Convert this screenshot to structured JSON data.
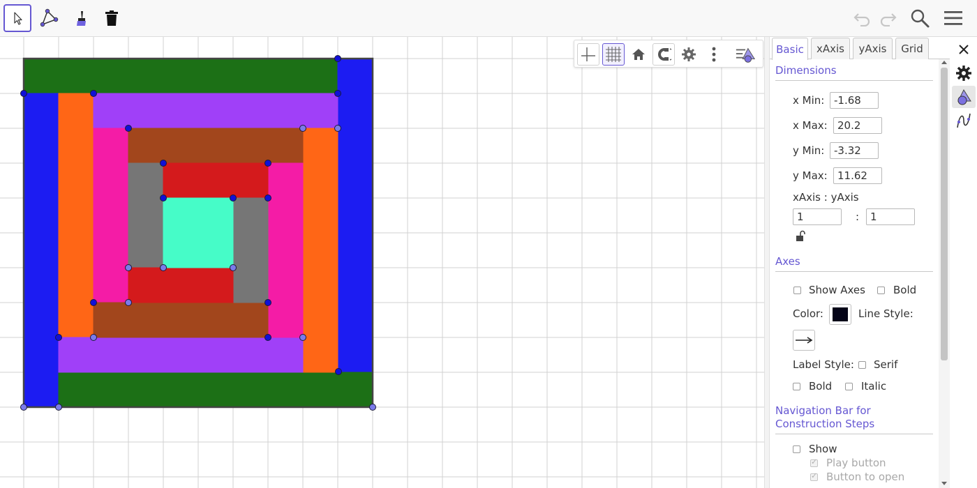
{
  "toolbar": {
    "tools": [
      {
        "name": "move-tool",
        "selected": true
      },
      {
        "name": "polygon-tool",
        "selected": false
      },
      {
        "name": "color-brush-tool",
        "selected": false
      },
      {
        "name": "delete-tool",
        "selected": false
      }
    ],
    "right_icons": [
      "undo-icon",
      "redo-icon",
      "search-icon",
      "menu-icon"
    ]
  },
  "graphics_style_bar": {
    "buttons": [
      "axes-toggle-icon",
      "grid-toggle-icon",
      "home-icon",
      "point-capture-icon",
      "settings-icon",
      "more-vertical-icon",
      "view-menu-icon"
    ]
  },
  "properties": {
    "tabs": [
      {
        "label": "Basic",
        "active": true
      },
      {
        "label": "xAxis",
        "active": false
      },
      {
        "label": "yAxis",
        "active": false
      },
      {
        "label": "Grid",
        "active": false
      }
    ],
    "dimensions": {
      "heading": "Dimensions",
      "x_min_label": "x Min:",
      "x_min_value": "-1.68",
      "x_max_label": "x Max:",
      "x_max_value": "20.2",
      "y_min_label": "y Min:",
      "y_min_value": "-3.32",
      "y_max_label": "y Max:",
      "y_max_value": "11.62",
      "ratio_label": "xAxis : yAxis",
      "ratio_x_value": "1",
      "ratio_sep": ":",
      "ratio_y_value": "1"
    },
    "axes": {
      "heading": "Axes",
      "show_axes_label": "Show Axes",
      "show_axes_checked": false,
      "bold_label": "Bold",
      "bold_checked": false,
      "color_label": "Color:",
      "axis_color": "#040418",
      "line_style_label": "Line Style:",
      "label_style_label": "Label Style:",
      "serif_label": "Serif",
      "label_bold_label": "Bold",
      "italic_label": "Italic"
    },
    "navigation": {
      "heading_line1": "Navigation Bar for",
      "heading_line2": "Construction Steps",
      "show_label": "Show",
      "play_button_label": "Play button",
      "button_to_open_label": "Button to open"
    }
  },
  "side_column": {
    "icons": [
      "settings-gear-icon",
      "graphics-style-icon",
      "algebra-curve-icon"
    ]
  },
  "construction": {
    "shapes": [
      {
        "name": "green-top-bar",
        "color": "#1c7016",
        "pts": [
          [
            0,
            10
          ],
          [
            9,
            10
          ],
          [
            9,
            9
          ],
          [
            0,
            9
          ]
        ]
      },
      {
        "name": "blue-right-bar",
        "color": "#1c1cf2",
        "pts": [
          [
            9,
            10
          ],
          [
            10,
            10
          ],
          [
            10,
            1
          ],
          [
            9,
            1
          ]
        ]
      },
      {
        "name": "blue-left-bar",
        "color": "#1c1cf2",
        "pts": [
          [
            0,
            9
          ],
          [
            1,
            9
          ],
          [
            1,
            0
          ],
          [
            0,
            0
          ]
        ]
      },
      {
        "name": "green-bottom-bar",
        "color": "#1c7016",
        "pts": [
          [
            1,
            1
          ],
          [
            10,
            1
          ],
          [
            10,
            0
          ],
          [
            1,
            0
          ]
        ]
      },
      {
        "name": "orange-left-bar",
        "color": "#ff6616",
        "pts": [
          [
            1,
            9
          ],
          [
            2,
            9
          ],
          [
            2,
            2
          ],
          [
            1,
            2
          ]
        ]
      },
      {
        "name": "purple-top-bar",
        "color": "#a040f8",
        "pts": [
          [
            2,
            9
          ],
          [
            9,
            9
          ],
          [
            9,
            8
          ],
          [
            2,
            8
          ]
        ]
      },
      {
        "name": "orange-right-bar",
        "color": "#ff6616",
        "pts": [
          [
            8,
            8
          ],
          [
            9,
            8
          ],
          [
            9,
            1
          ],
          [
            8,
            1
          ]
        ]
      },
      {
        "name": "purple-bottom-bar",
        "color": "#a040f8",
        "pts": [
          [
            1,
            2
          ],
          [
            8,
            2
          ],
          [
            8,
            1
          ],
          [
            1,
            1
          ]
        ]
      },
      {
        "name": "pink-left-bar",
        "color": "#f41ca6",
        "pts": [
          [
            2,
            8
          ],
          [
            3,
            8
          ],
          [
            3,
            3
          ],
          [
            2,
            3
          ]
        ]
      },
      {
        "name": "brown-top-bar",
        "color": "#a2461c",
        "pts": [
          [
            3,
            8
          ],
          [
            8,
            8
          ],
          [
            8,
            7
          ],
          [
            3,
            7
          ]
        ]
      },
      {
        "name": "pink-right-bar",
        "color": "#f41ca6",
        "pts": [
          [
            7,
            7
          ],
          [
            8,
            7
          ],
          [
            8,
            2
          ],
          [
            7,
            2
          ]
        ]
      },
      {
        "name": "brown-bottom-bar",
        "color": "#a2461c",
        "pts": [
          [
            2,
            3
          ],
          [
            7,
            3
          ],
          [
            7,
            2
          ],
          [
            2,
            2
          ]
        ]
      },
      {
        "name": "gray-left-bar",
        "color": "#767676",
        "pts": [
          [
            3,
            7
          ],
          [
            4,
            7
          ],
          [
            4,
            4
          ],
          [
            3,
            4
          ]
        ]
      },
      {
        "name": "red-top-bar",
        "color": "#d41a1c",
        "pts": [
          [
            4,
            7
          ],
          [
            7,
            7
          ],
          [
            7,
            6
          ],
          [
            4,
            6
          ]
        ]
      },
      {
        "name": "gray-right-bar",
        "color": "#767676",
        "pts": [
          [
            6,
            6
          ],
          [
            7,
            6
          ],
          [
            7,
            3
          ],
          [
            6,
            3
          ]
        ]
      },
      {
        "name": "red-bottom-bar",
        "color": "#d41a1c",
        "pts": [
          [
            3,
            4
          ],
          [
            6,
            4
          ],
          [
            6,
            3
          ],
          [
            3,
            3
          ]
        ]
      },
      {
        "name": "center-square",
        "color": "#46fcc8",
        "pts": [
          [
            4,
            6
          ],
          [
            6,
            6
          ],
          [
            6,
            4
          ],
          [
            4,
            4
          ]
        ]
      }
    ],
    "points_dark": [
      [
        9,
        10
      ],
      [
        0,
        9
      ],
      [
        2,
        9
      ],
      [
        9,
        9
      ],
      [
        3,
        8
      ],
      [
        4,
        7
      ],
      [
        7,
        7
      ],
      [
        4,
        6
      ],
      [
        6,
        6
      ],
      [
        7,
        6
      ],
      [
        2,
        3
      ],
      [
        7,
        3
      ],
      [
        1,
        2
      ],
      [
        7,
        2
      ],
      [
        9.02,
        1.02
      ]
    ],
    "points_light": [
      [
        8,
        8
      ],
      [
        9,
        8
      ],
      [
        3,
        4
      ],
      [
        4,
        4
      ],
      [
        6,
        4
      ],
      [
        3,
        3
      ],
      [
        2,
        2
      ],
      [
        8,
        2
      ],
      [
        0,
        0
      ],
      [
        1,
        0
      ],
      [
        10,
        0
      ]
    ]
  }
}
